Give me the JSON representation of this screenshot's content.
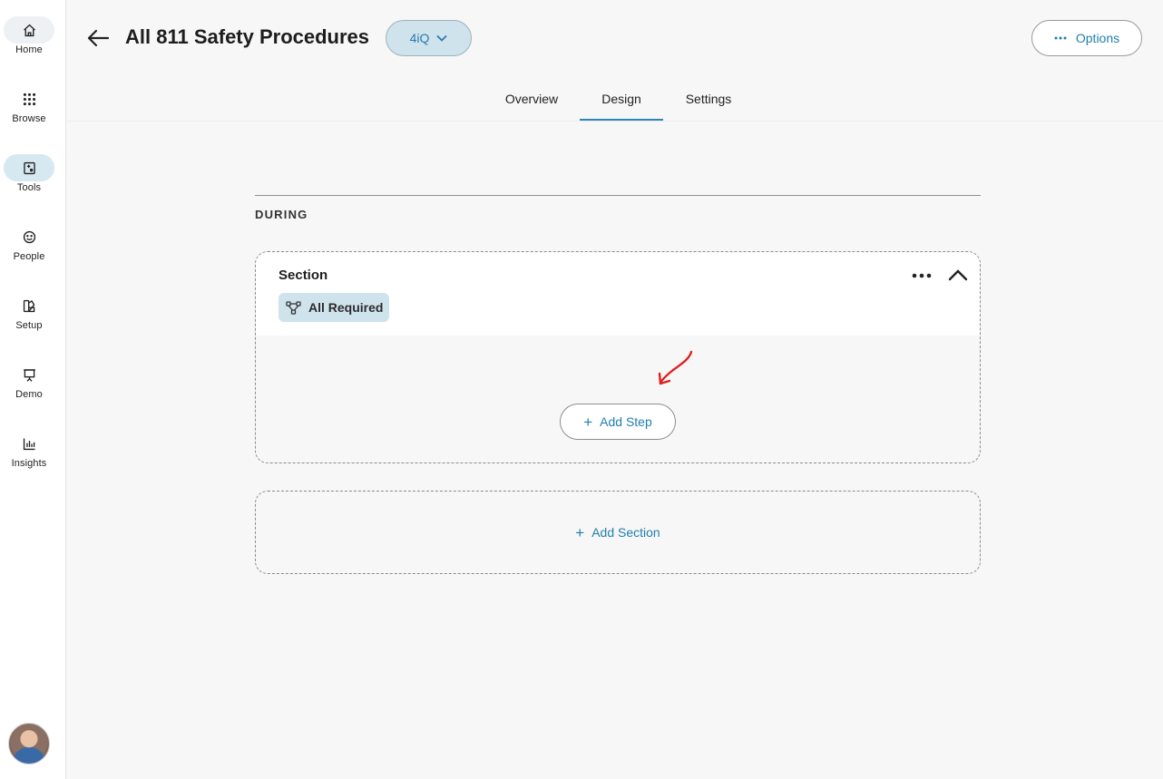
{
  "nav": {
    "items": [
      {
        "label": "Home",
        "icon": "home-icon"
      },
      {
        "label": "Browse",
        "icon": "grid-dots-icon"
      },
      {
        "label": "Tools",
        "icon": "tools-icon"
      },
      {
        "label": "People",
        "icon": "smiley-icon"
      },
      {
        "label": "Setup",
        "icon": "setup-icon"
      },
      {
        "label": "Demo",
        "icon": "presentation-icon"
      },
      {
        "label": "Insights",
        "icon": "bar-chart-icon"
      }
    ],
    "active": "Tools"
  },
  "header": {
    "title": "All 811 Safety Procedures",
    "org_selector": "4iQ",
    "options_label": "Options"
  },
  "tabs": [
    {
      "label": "Overview"
    },
    {
      "label": "Design"
    },
    {
      "label": "Settings"
    }
  ],
  "active_tab": "Design",
  "phase": {
    "label": "DURING"
  },
  "section": {
    "title": "Section",
    "requirement_chip": "All Required",
    "add_step_label": "Add Step"
  },
  "add_section_label": "Add Section",
  "colors": {
    "accent": "#1f7fae",
    "chip_bg": "#cfe3ec",
    "active_nav_bg": "#d6e8f0",
    "annotation_arrow": "#e02020"
  }
}
